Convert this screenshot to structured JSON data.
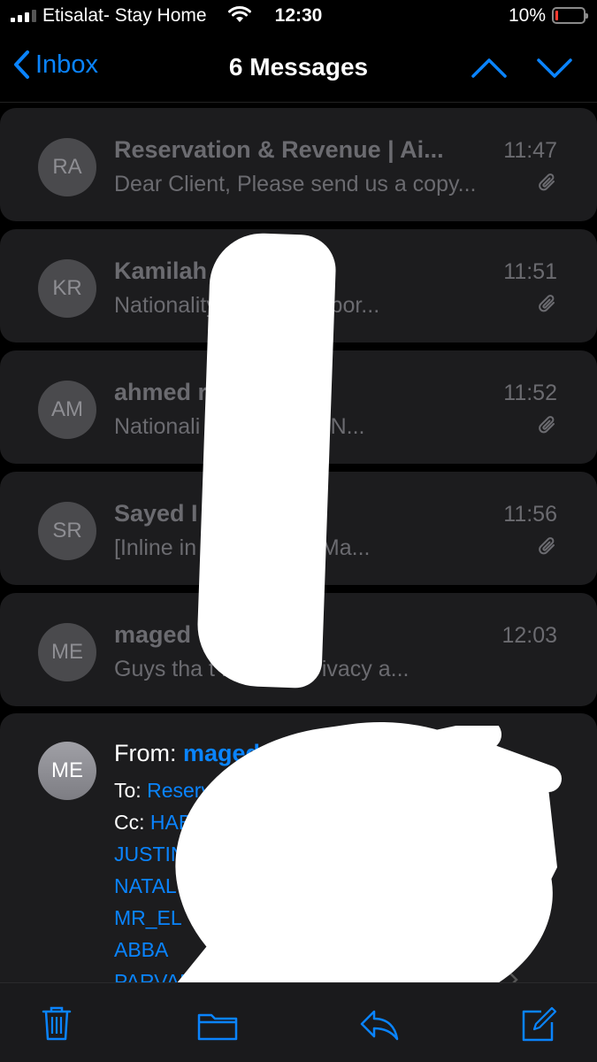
{
  "status_bar": {
    "carrier": "Etisalat- Stay Home",
    "time": "12:30",
    "battery": "10%",
    "battery_level": 0.1,
    "battery_color": "#ff3b30"
  },
  "nav": {
    "back_label": "Inbox",
    "title": "6 Messages"
  },
  "messages": [
    {
      "initials": "RA",
      "sender": "Reservation & Revenue | Ai...",
      "time": "11:47",
      "preview": "Dear Client, Please send us a copy..."
    },
    {
      "initials": "KR",
      "sender": "Kamilah R",
      "time": "11:51",
      "preview": "Nationality itizen Passpor..."
    },
    {
      "initials": "AM",
      "sender": "ahmed r",
      "time": "11:52",
      "preview": "Nationali an Passport N..."
    },
    {
      "initials": "SR",
      "sender": "Sayed I",
      "time": "11:56",
      "preview": "[Inline in from Yahoo Ma..."
    },
    {
      "initials": "ME",
      "sender": "maged",
      "time": "12:03",
      "preview": "Guys tha t for your privacy a..."
    }
  ],
  "expanded": {
    "initials": "ME",
    "from_label": "From:",
    "from_name": "maged",
    "to_label": "To:",
    "to_value": "Reserva",
    "cc_label": "Cc:",
    "cc_value": "HABI",
    "recipients": [
      "JUSTIN",
      "NATAL",
      "MR_EL",
      "ABBA",
      "PARVANA_CARL@..."
    ]
  },
  "colors": {
    "accent": "#0a84ff",
    "card": "#1c1c1e",
    "dim_text": "#6b6b70"
  },
  "toolbar": {
    "icons": [
      "trash-icon",
      "folder-icon",
      "reply-icon",
      "compose-icon"
    ]
  }
}
